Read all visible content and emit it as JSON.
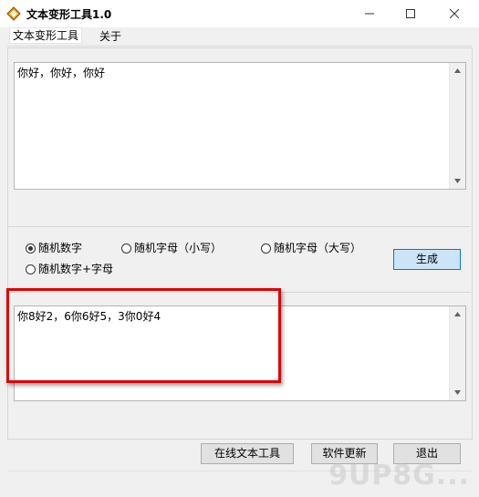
{
  "window": {
    "title": "文本变形工具1.0",
    "minimize_icon": "minimize-icon",
    "maximize_icon": "maximize-icon",
    "close_icon": "close-icon"
  },
  "menu": {
    "items": [
      {
        "label": "文本变形工具"
      },
      {
        "label": "关于"
      }
    ]
  },
  "input_box": {
    "value": "你好，你好，你好"
  },
  "options": {
    "radios": [
      {
        "label": "随机数字",
        "checked": true
      },
      {
        "label": "随机字母（小写）",
        "checked": false
      },
      {
        "label": "随机字母（大写）",
        "checked": false
      },
      {
        "label": "随机数字+字母",
        "checked": false
      }
    ],
    "generate_label": "生成"
  },
  "output_box": {
    "value": "你8好2，6你6好5，3你0好4"
  },
  "footer": {
    "online_tools_label": "在线文本工具",
    "update_label": "软件更新",
    "exit_label": "退出"
  },
  "watermark": "9UP8G..."
}
